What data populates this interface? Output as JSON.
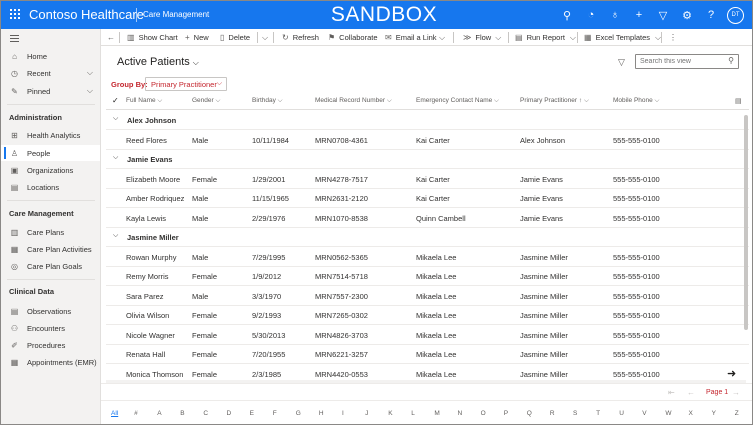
{
  "app": {
    "name": "Contoso Healthcare",
    "area": "Care Management",
    "banner": "SANDBOX",
    "user_initials": "DT"
  },
  "sidebar": {
    "top": [
      {
        "label": "Home",
        "icon": "home-icon"
      },
      {
        "label": "Recent",
        "icon": "clock-icon"
      },
      {
        "label": "Pinned",
        "icon": "pin-icon"
      }
    ],
    "sections": [
      {
        "title": "Administration",
        "items": [
          {
            "label": "Health Analytics"
          },
          {
            "label": "People"
          },
          {
            "label": "Organizations"
          },
          {
            "label": "Locations"
          }
        ]
      },
      {
        "title": "Care Management",
        "items": [
          {
            "label": "Care Plans"
          },
          {
            "label": "Care Plan Activities"
          },
          {
            "label": "Care Plan Goals"
          }
        ]
      },
      {
        "title": "Clinical Data",
        "items": [
          {
            "label": "Observations"
          },
          {
            "label": "Encounters"
          },
          {
            "label": "Procedures"
          },
          {
            "label": "Appointments (EMR)"
          }
        ]
      }
    ],
    "selected": "People"
  },
  "commands": {
    "show_chart": "Show Chart",
    "new": "New",
    "delete": "Delete",
    "refresh": "Refresh",
    "collaborate": "Collaborate",
    "email_link": "Email a Link",
    "flow": "Flow",
    "run_report": "Run Report",
    "excel_templates": "Excel Templates"
  },
  "view": {
    "title": "Active Patients",
    "search_placeholder": "Search this view",
    "group_by_label": "Group By:",
    "group_by_value": "Primary Practitioner"
  },
  "grid": {
    "columns": [
      "Full Name",
      "Gender",
      "Birthday",
      "Medical Record Number",
      "Emergency Contact Name",
      "Primary Practitioner",
      "Mobile Phone"
    ],
    "groups": [
      {
        "name": "Alex Johnson",
        "rows": [
          [
            "Reed Flores",
            "Male",
            "10/11/1984",
            "MRN0708-4361",
            "Kai Carter",
            "Alex Johnson",
            "555-555-0100"
          ]
        ]
      },
      {
        "name": "Jamie Evans",
        "rows": [
          [
            "Elizabeth Moore",
            "Female",
            "1/29/2001",
            "MRN4278-7517",
            "Kai Carter",
            "Jamie Evans",
            "555-555-0100"
          ],
          [
            "Amber Rodriquez",
            "Male",
            "11/15/1965",
            "MRN2631-2120",
            "Kai Carter",
            "Jamie Evans",
            "555-555-0100"
          ],
          [
            "Kayla Lewis",
            "Male",
            "2/29/1976",
            "MRN1070-8538",
            "Quinn Cambell",
            "Jamie Evans",
            "555-555-0100"
          ]
        ]
      },
      {
        "name": "Jasmine Miller",
        "rows": [
          [
            "Rowan Murphy",
            "Male",
            "7/29/1995",
            "MRN0562-5365",
            "Mikaela Lee",
            "Jasmine Miller",
            "555-555-0100"
          ],
          [
            "Remy Morris",
            "Female",
            "1/9/2012",
            "MRN7514-5718",
            "Mikaela Lee",
            "Jasmine Miller",
            "555-555-0100"
          ],
          [
            "Sara Parez",
            "Male",
            "3/3/1970",
            "MRN7557-2300",
            "Mikaela Lee",
            "Jasmine Miller",
            "555-555-0100"
          ],
          [
            "Olivia Wilson",
            "Female",
            "9/2/1993",
            "MRN7265-0302",
            "Mikaela Lee",
            "Jasmine Miller",
            "555-555-0100"
          ],
          [
            "Nicole Wagner",
            "Female",
            "5/30/2013",
            "MRN4826-3703",
            "Mikaela Lee",
            "Jasmine Miller",
            "555-555-0100"
          ],
          [
            "Renata Hall",
            "Female",
            "7/20/1955",
            "MRN6221-3257",
            "Mikaela Lee",
            "Jasmine Miller",
            "555-555-0100"
          ],
          [
            "Monica Thomson",
            "Female",
            "2/3/1985",
            "MRN4420-0553",
            "Mikaela Lee",
            "Jasmine Miller",
            "555-555-0100"
          ]
        ]
      }
    ]
  },
  "pager": {
    "label": "Page 1"
  },
  "alphabet": [
    "All",
    "#",
    "A",
    "B",
    "C",
    "D",
    "E",
    "F",
    "G",
    "H",
    "I",
    "J",
    "K",
    "L",
    "M",
    "N",
    "O",
    "P",
    "Q",
    "R",
    "S",
    "T",
    "U",
    "V",
    "W",
    "X",
    "Y",
    "Z"
  ],
  "colors": {
    "brand": "#1677ee",
    "accent_red": "#c4262e"
  }
}
